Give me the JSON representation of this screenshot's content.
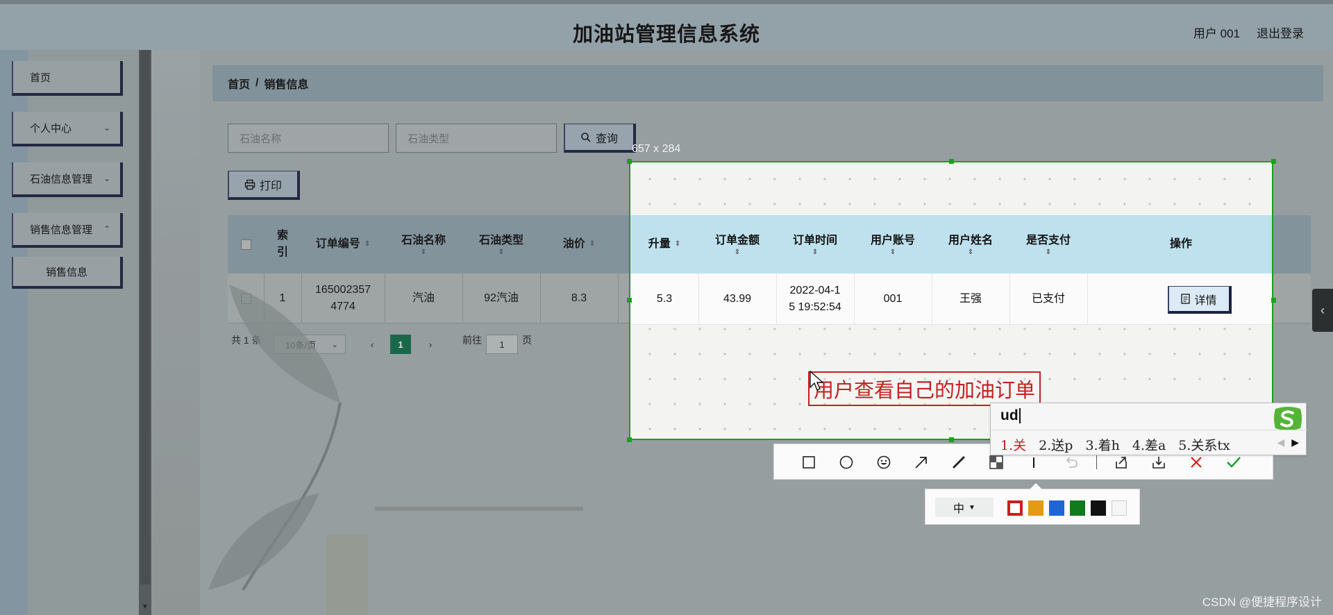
{
  "app": {
    "title": "加油站管理信息系统",
    "user": "用户 001",
    "logout": "退出登录"
  },
  "sidebar": {
    "items": [
      {
        "label": "首页"
      },
      {
        "label": "个人中心"
      },
      {
        "label": "石油信息管理"
      },
      {
        "label": "销售信息管理"
      },
      {
        "label": "销售信息"
      }
    ]
  },
  "breadcrumb": {
    "home": "首页",
    "sep": "/",
    "current": "销售信息"
  },
  "search": {
    "name_placeholder": "石油名称",
    "type_placeholder": "石油类型",
    "query_label": "查询",
    "print_label": "打印"
  },
  "table": {
    "headers": [
      "索引",
      "订单编号",
      "石油名称",
      "石油类型",
      "油价",
      "升量",
      "订单金额",
      "订单时间",
      "用户账号",
      "用户姓名",
      "是否支付",
      "操作"
    ],
    "row": {
      "index": "1",
      "order_no_1": "165002357",
      "order_no_2": "4774",
      "oil_name": "汽油",
      "oil_type": "92汽油",
      "price": "8.3",
      "liters": "5.3",
      "amount": "43.99",
      "time_1": "2022-04-1",
      "time_2": "5 19:52:54",
      "account": "001",
      "user_name": "王强",
      "paid": "已支付",
      "detail_label": "详情"
    }
  },
  "pagination": {
    "total": "共 1 条",
    "page_size": "10条/页",
    "current_page": "1",
    "goto_prefix": "前往",
    "goto_value": "1",
    "goto_suffix": "页"
  },
  "capture": {
    "size_label": "657 x 284",
    "annotation": "用户查看自己的加油订单"
  },
  "color_panel": {
    "size": "中",
    "colors": [
      "#d01b1b",
      "#e49a12",
      "#1f66d3",
      "#127a1e",
      "#111111",
      "#f5f5f5"
    ]
  },
  "ime": {
    "input": "ud",
    "candidates": [
      "1.关",
      "2.送p",
      "3.着h",
      "4.差a",
      "5.关系tx"
    ]
  },
  "watermark": "CSDN @便捷程序设计"
}
